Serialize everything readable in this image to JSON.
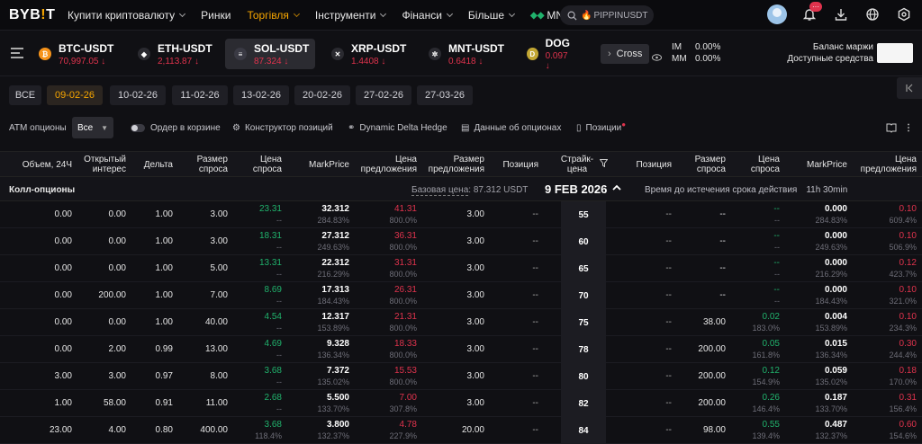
{
  "logo": {
    "text_a": "BYB",
    "text_b": "!",
    "text_c": "T"
  },
  "nav": {
    "items": [
      "Купити криптовалюту",
      "Ринки",
      "Торгівля",
      "Інструменти",
      "Фінанси",
      "Більше"
    ],
    "active": "Торгівля",
    "mnt": "MNT",
    "search_placeholder": "PIPPINUSDT",
    "notification_count": "···"
  },
  "tickers": [
    {
      "name": "BTC-USDT",
      "price": "70,997.05",
      "icon": "btc-icon",
      "color": "#f7931a",
      "glyph": "₿"
    },
    {
      "name": "ETH-USDT",
      "price": "2,113.87",
      "icon": "eth-icon",
      "color": "#2a2a30",
      "glyph": "◆"
    },
    {
      "name": "SOL-USDT",
      "price": "87.324",
      "icon": "sol-icon",
      "color": "#3a3a44",
      "glyph": "≡"
    },
    {
      "name": "XRP-USDT",
      "price": "1.4408",
      "icon": "xrp-icon",
      "color": "#2a2a30",
      "glyph": "✕"
    },
    {
      "name": "MNT-USDT",
      "price": "0.6418",
      "icon": "mnt-icon",
      "color": "#2a2a30",
      "glyph": "✲"
    },
    {
      "name": "DOG",
      "price": "0.097",
      "icon": "doge-icon",
      "color": "#c2a633",
      "glyph": "D"
    }
  ],
  "margin": {
    "cross_label": "Cross",
    "im_label": "IM",
    "im_value": "0.00%",
    "mm_label": "MM",
    "mm_value": "0.00%",
    "balance_label": "Баланс маржи",
    "available_label": "Доступные средства"
  },
  "dates": [
    "ВСЕ",
    "09-02-26",
    "10-02-26",
    "11-02-26",
    "13-02-26",
    "20-02-26",
    "27-02-26",
    "27-03-26"
  ],
  "active_date": "09-02-26",
  "options_bar": {
    "atm_label": "ATM опционы",
    "select_value": "Все",
    "basket_label": "Ордер в корзине",
    "builder_label": "Конструктор позиций",
    "delta_hedge_label": "Dynamic Delta Hedge",
    "data_label": "Данные об опционах",
    "positions_label": "Позиции"
  },
  "headers": {
    "volume": "Объем, 24Ч",
    "open_interest_a": "Открытый",
    "open_interest_b": "интерес",
    "delta": "Дельта",
    "bid_size_a": "Размер",
    "bid_size_b": "спроса",
    "bid_a": "Цена",
    "bid_b": "спроса",
    "mark": "MarkPrice",
    "ask_a": "Цена",
    "ask_b": "предложения",
    "ask_size_a": "Размер",
    "ask_size_b": "предложения",
    "position": "Позиция",
    "strike_a": "Страйк-",
    "strike_b": "цена",
    "p_position": "Позиция",
    "p_bid_size_a": "Размер",
    "p_bid_size_b": "спроса",
    "p_bid_a": "Цена",
    "p_bid_b": "спроса",
    "p_mark": "MarkPrice",
    "p_ask_a": "Цена",
    "p_ask_b": "предложения"
  },
  "group": {
    "title": "Колл-опционы",
    "base_label": "Базовая цена",
    "base_value": ": 87.312 USDT",
    "expiry": "9 FEB 2026",
    "time_label": "Время до истечения срока действия",
    "time_value": "11h 30min"
  },
  "rows": [
    {
      "vol": "0.00",
      "oi": "0.00",
      "delta": "1.00",
      "bsize": "3.00",
      "bid": "23.31",
      "bidsub": "--",
      "mark": "32.312",
      "marksub": "284.83%",
      "ask": "41.31",
      "asksub": "800.0%",
      "asize": "3.00",
      "pos": "--",
      "strike": "55",
      "ppos": "--",
      "pbsize": "--",
      "pbid": "--",
      "pbidsub": "--",
      "pmark": "0.000",
      "pmarksub": "284.83%",
      "pask": "0.10",
      "pasksub": "609.4%"
    },
    {
      "vol": "0.00",
      "oi": "0.00",
      "delta": "1.00",
      "bsize": "3.00",
      "bid": "18.31",
      "bidsub": "--",
      "mark": "27.312",
      "marksub": "249.63%",
      "ask": "36.31",
      "asksub": "800.0%",
      "asize": "3.00",
      "pos": "--",
      "strike": "60",
      "ppos": "--",
      "pbsize": "--",
      "pbid": "--",
      "pbidsub": "--",
      "pmark": "0.000",
      "pmarksub": "249.63%",
      "pask": "0.10",
      "pasksub": "506.9%"
    },
    {
      "vol": "0.00",
      "oi": "0.00",
      "delta": "1.00",
      "bsize": "5.00",
      "bid": "13.31",
      "bidsub": "--",
      "mark": "22.312",
      "marksub": "216.29%",
      "ask": "31.31",
      "asksub": "800.0%",
      "asize": "3.00",
      "pos": "--",
      "strike": "65",
      "ppos": "--",
      "pbsize": "--",
      "pbid": "--",
      "pbidsub": "--",
      "pmark": "0.000",
      "pmarksub": "216.29%",
      "pask": "0.12",
      "pasksub": "423.7%"
    },
    {
      "vol": "0.00",
      "oi": "200.00",
      "delta": "1.00",
      "bsize": "7.00",
      "bid": "8.69",
      "bidsub": "--",
      "mark": "17.313",
      "marksub": "184.43%",
      "ask": "26.31",
      "asksub": "800.0%",
      "asize": "3.00",
      "pos": "--",
      "strike": "70",
      "ppos": "--",
      "pbsize": "--",
      "pbid": "--",
      "pbidsub": "--",
      "pmark": "0.000",
      "pmarksub": "184.43%",
      "pask": "0.10",
      "pasksub": "321.0%"
    },
    {
      "vol": "0.00",
      "oi": "0.00",
      "delta": "1.00",
      "bsize": "40.00",
      "bid": "4.54",
      "bidsub": "--",
      "mark": "12.317",
      "marksub": "153.89%",
      "ask": "21.31",
      "asksub": "800.0%",
      "asize": "3.00",
      "pos": "--",
      "strike": "75",
      "ppos": "--",
      "pbsize": "38.00",
      "pbid": "0.02",
      "pbidsub": "183.0%",
      "pmark": "0.004",
      "pmarksub": "153.89%",
      "pask": "0.10",
      "pasksub": "234.3%"
    },
    {
      "vol": "0.00",
      "oi": "2.00",
      "delta": "0.99",
      "bsize": "13.00",
      "bid": "4.69",
      "bidsub": "--",
      "mark": "9.328",
      "marksub": "136.34%",
      "ask": "18.33",
      "asksub": "800.0%",
      "asize": "3.00",
      "pos": "--",
      "strike": "78",
      "ppos": "--",
      "pbsize": "200.00",
      "pbid": "0.05",
      "pbidsub": "161.8%",
      "pmark": "0.015",
      "pmarksub": "136.34%",
      "pask": "0.30",
      "pasksub": "244.4%"
    },
    {
      "vol": "3.00",
      "oi": "3.00",
      "delta": "0.97",
      "bsize": "8.00",
      "bid": "3.68",
      "bidsub": "--",
      "mark": "7.372",
      "marksub": "135.02%",
      "ask": "15.53",
      "asksub": "800.0%",
      "asize": "3.00",
      "pos": "--",
      "strike": "80",
      "ppos": "--",
      "pbsize": "200.00",
      "pbid": "0.12",
      "pbidsub": "154.9%",
      "pmark": "0.059",
      "pmarksub": "135.02%",
      "pask": "0.18",
      "pasksub": "170.0%"
    },
    {
      "vol": "1.00",
      "oi": "58.00",
      "delta": "0.91",
      "bsize": "11.00",
      "bid": "2.68",
      "bidsub": "--",
      "mark": "5.500",
      "marksub": "133.70%",
      "ask": "7.00",
      "asksub": "307.8%",
      "asize": "3.00",
      "pos": "--",
      "strike": "82",
      "ppos": "--",
      "pbsize": "200.00",
      "pbid": "0.26",
      "pbidsub": "146.4%",
      "pmark": "0.187",
      "pmarksub": "133.70%",
      "pask": "0.31",
      "pasksub": "156.4%"
    },
    {
      "vol": "23.00",
      "oi": "4.00",
      "delta": "0.80",
      "bsize": "400.00",
      "bid": "3.68",
      "bidsub": "118.4%",
      "mark": "3.800",
      "marksub": "132.37%",
      "ask": "4.78",
      "asksub": "227.9%",
      "asize": "20.00",
      "pos": "--",
      "strike": "84",
      "ppos": "--",
      "pbsize": "98.00",
      "pbid": "0.55",
      "pbidsub": "139.4%",
      "pmark": "0.487",
      "pmarksub": "132.37%",
      "pask": "0.60",
      "pasksub": "154.6%"
    }
  ]
}
